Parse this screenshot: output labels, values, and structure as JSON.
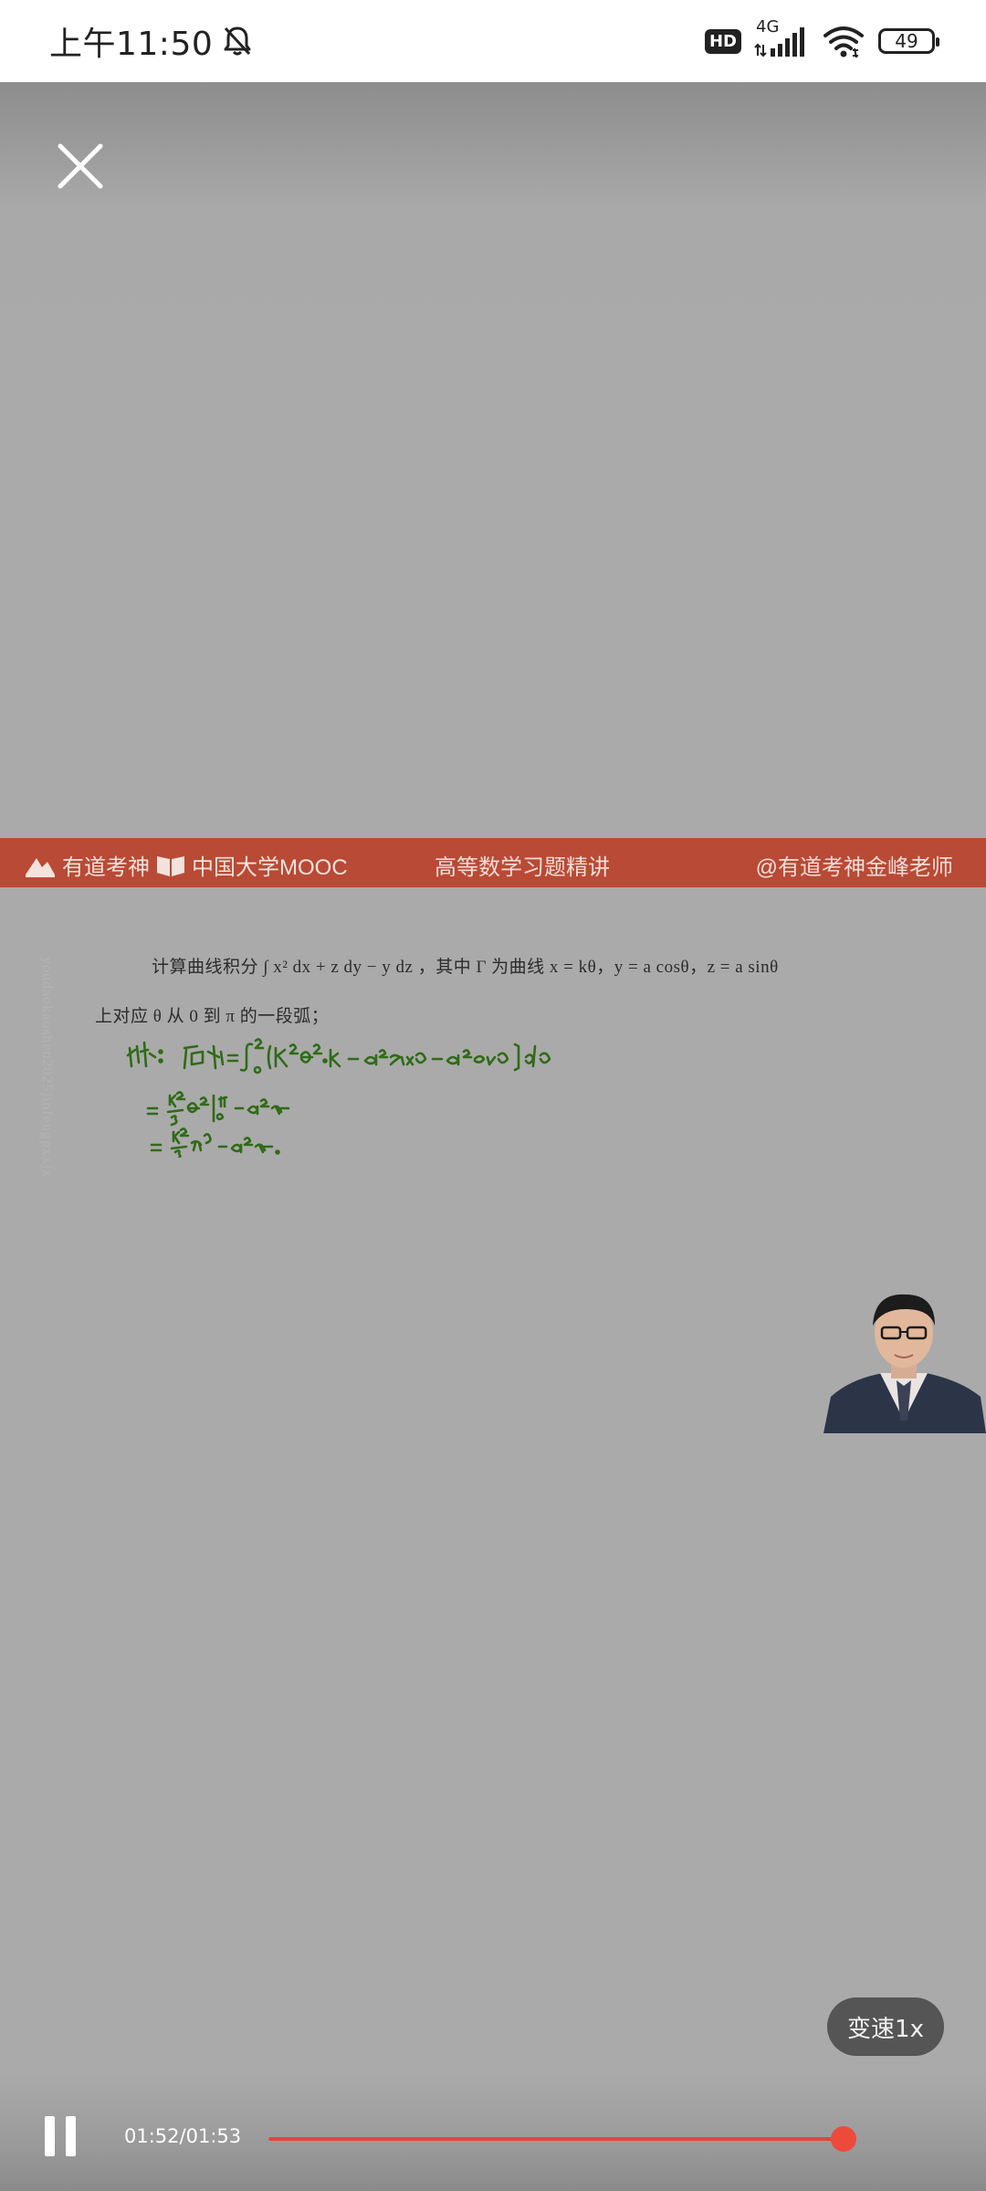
{
  "status_bar": {
    "time": "上午11:50",
    "network_badge": "HD",
    "network_type": "4G",
    "battery": "49",
    "icons": [
      "mute-bell-icon",
      "signal-icon",
      "wifi-icon",
      "battery-icon"
    ]
  },
  "video": {
    "banner": {
      "brand_1": "有道考神",
      "brand_2": "中国大学MOOC",
      "center_title": "高等数学习题精讲",
      "right_credit": "@有道考神金峰老师"
    },
    "problem": {
      "line1": "计算曲线积分 ∫ x² dx + z dy − y dz ，其中 Γ 为曲线 x = kθ，y = a cosθ，z = a sinθ",
      "line2": "上对应 θ 从 0 到 π 的一段弧；"
    },
    "watermark": "youdaokaoshen2025jinfengpxxjx"
  },
  "controls": {
    "speed_label": "变速1x",
    "time": "01:52/01:53",
    "progress": 0.991
  },
  "colors": {
    "banner": "#b94a35",
    "progress": "#e0463a",
    "handwriting": "#2f6b16"
  }
}
